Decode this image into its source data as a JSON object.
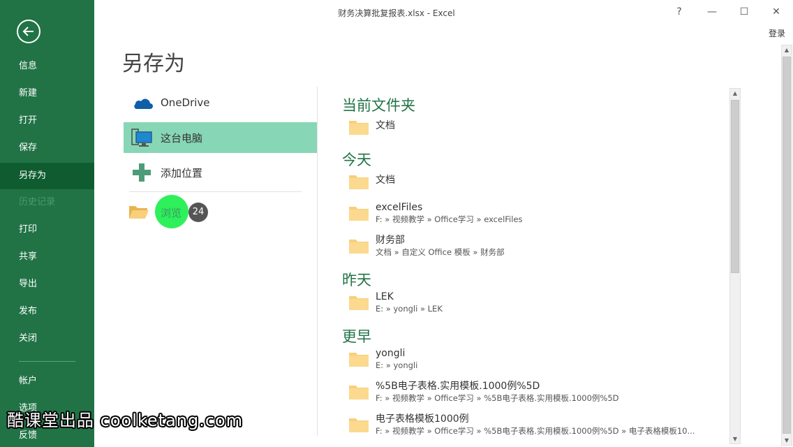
{
  "window": {
    "title": "财务决算批复报表.xlsx - Excel",
    "help": "?",
    "minimize": "—",
    "maximize": "☐",
    "close": "✕",
    "login": "登录"
  },
  "nav": {
    "items": [
      {
        "label": "信息"
      },
      {
        "label": "新建"
      },
      {
        "label": "打开"
      },
      {
        "label": "保存"
      },
      {
        "label": "另存为",
        "active": true
      },
      {
        "label": "历史记录",
        "disabled": true
      },
      {
        "label": "打印"
      },
      {
        "label": "共享"
      },
      {
        "label": "导出"
      },
      {
        "label": "发布"
      },
      {
        "label": "关闭"
      },
      {
        "label": "帐户"
      },
      {
        "label": "选项"
      },
      {
        "label": "反馈"
      }
    ]
  },
  "page": {
    "title": "另存为"
  },
  "locations": [
    {
      "label": "OneDrive",
      "icon": "cloud-icon"
    },
    {
      "label": "这台电脑",
      "icon": "computer-icon",
      "selected": true
    },
    {
      "label": "添加位置",
      "icon": "plus-icon"
    }
  ],
  "browse": {
    "label": "浏览",
    "step": "24",
    "icon": "folder-open-icon"
  },
  "recent": {
    "current": {
      "heading": "当前文件夹",
      "items": [
        {
          "name": "文档",
          "path": ""
        }
      ]
    },
    "today": {
      "heading": "今天",
      "items": [
        {
          "name": "文档",
          "path": ""
        },
        {
          "name": "excelFiles",
          "path": "F: » 视频教学 » Office学习 » excelFiles"
        },
        {
          "name": "财务部",
          "path": "文档 » 自定义 Office 模板 » 财务部"
        }
      ]
    },
    "yesterday": {
      "heading": "昨天",
      "items": [
        {
          "name": "LEK",
          "path": "E: » yongli » LEK"
        }
      ]
    },
    "earlier": {
      "heading": "更早",
      "items": [
        {
          "name": "yongli",
          "path": "E: » yongli"
        },
        {
          "name": "%5B电子表格.实用模板.1000例%5D",
          "path": "F: » 视频教学 » Office学习 » %5B电子表格.实用模板.1000例%5D"
        },
        {
          "name": "电子表格模板1000例",
          "path": "F: » 视频教学 » Office学习 » %5B电子表格.实用模板.1000例%5D » 电子表格模板10..."
        }
      ]
    }
  },
  "colors": {
    "accent": "#217346",
    "selected": "#87d7b6",
    "highlight": "#2ef05b"
  },
  "watermark": "酷课堂出品 coolketang.com"
}
